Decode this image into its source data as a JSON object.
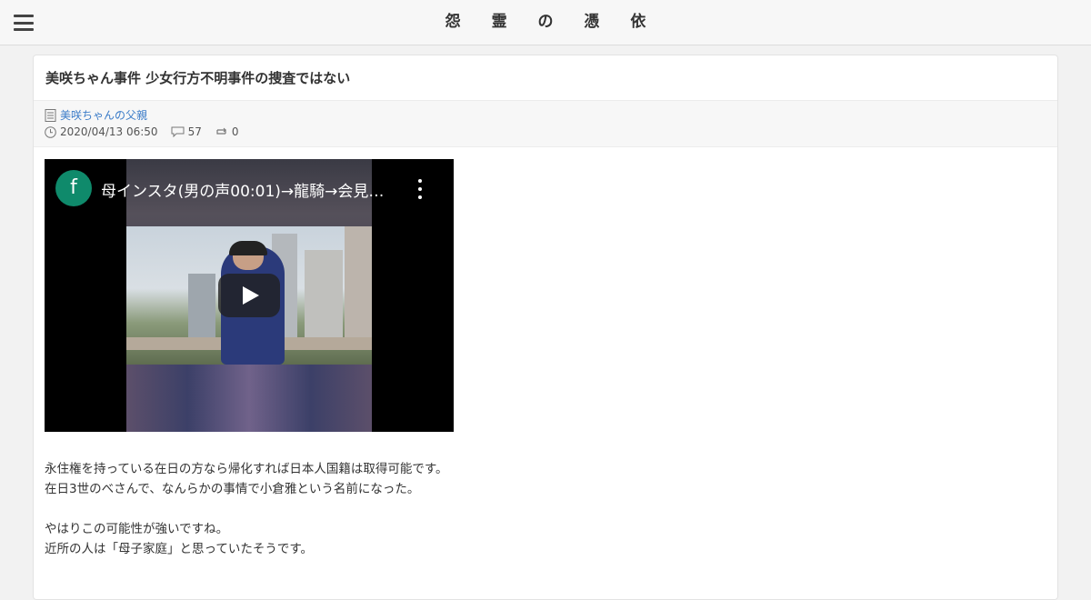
{
  "header": {
    "site_title": "怨 霊 の 憑 依",
    "menu_icon": "hamburger-menu-icon"
  },
  "post": {
    "title": "美咲ちゃん事件 少女行方不明事件の捜査ではない",
    "category_icon": "document-icon",
    "author": "美咲ちゃんの父親",
    "date": "2020/04/13 06:50",
    "comment_count": "57",
    "reblog_count": "0",
    "icons": [
      "clock-icon",
      "comment-icon",
      "repost-icon"
    ]
  },
  "video": {
    "channel_initial": "f",
    "title": "母インスタ(男の声00:01)→龍騎→会見…",
    "channel_color": "#0f8a6b"
  },
  "body": {
    "p1_line1": "永住権を持っている在日の方なら帰化すれば日本人国籍は取得可能です。",
    "p1_line2": "在日3世のべさんで、なんらかの事情で小倉雅という名前になった。",
    "p2_line1": "やはりこの可能性が強いですね。",
    "p2_line2": "近所の人は「母子家庭」と思っていたそうです。"
  },
  "colors": {
    "link": "#3a7bc8",
    "header_bg": "#f7f7f7"
  }
}
